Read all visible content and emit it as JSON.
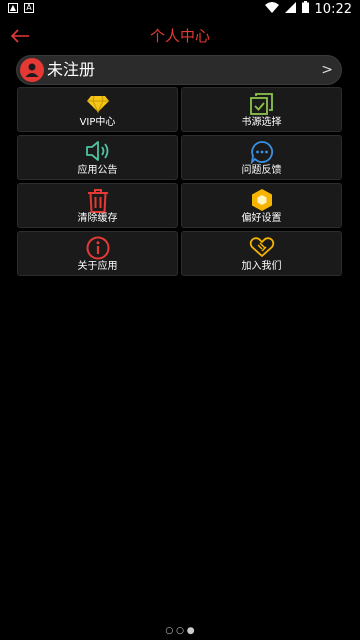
{
  "status_bar": {
    "time": "10:22"
  },
  "app_bar": {
    "title": "个人中心"
  },
  "profile": {
    "name": "未注册"
  },
  "menu": [
    {
      "label": "VIP中心",
      "icon": "diamond-icon",
      "color": "#f5c518"
    },
    {
      "label": "书源选择",
      "icon": "checkbox-stack-icon",
      "color": "#8bc34a"
    },
    {
      "label": "应用公告",
      "icon": "speaker-icon",
      "color": "#4fc3a1"
    },
    {
      "label": "问题反馈",
      "icon": "chat-bubble-icon",
      "color": "#3b8fe0"
    },
    {
      "label": "清除缓存",
      "icon": "trash-icon",
      "color": "#e53935"
    },
    {
      "label": "偏好设置",
      "icon": "hexagon-icon",
      "color": "#f5b400"
    },
    {
      "label": "关于应用",
      "icon": "info-icon",
      "color": "#e53935"
    },
    {
      "label": "加入我们",
      "icon": "handshake-icon",
      "color": "#f5b400"
    }
  ]
}
